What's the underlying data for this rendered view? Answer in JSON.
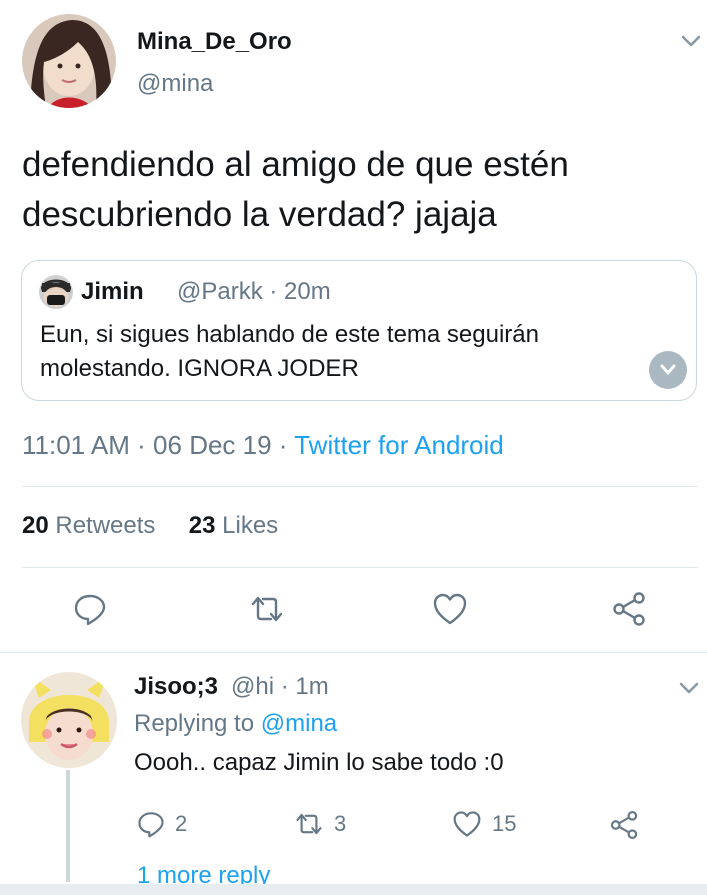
{
  "tweet": {
    "author_name": "Mina_De_Oro",
    "author_handle": "@mina",
    "text": "defendiendo al amigo de que estén descubriendo la verdad? jajaja",
    "quote": {
      "name": "Jimin",
      "handle": "@Parkk",
      "separator": " · ",
      "time": "20m",
      "text": "Eun, si sigues hablando de este tema seguirán molestando. IGNORA JODER"
    },
    "time": "11:01 AM",
    "date": "06 Dec 19",
    "separator": " · ",
    "source": "Twitter for Android",
    "retweets_count": "20",
    "retweets_label": "Retweets",
    "likes_count": "23",
    "likes_label": "Likes",
    "actions": [
      "reply-icon",
      "retweet-icon",
      "like-icon",
      "share-icon"
    ]
  },
  "reply": {
    "author_name": "Jisoo;3",
    "author_handle": "@hi",
    "separator": " · ",
    "time": "1m",
    "replying_prefix": "Replying to ",
    "replying_to": "@mina",
    "text": "Oooh.. capaz Jimin lo sabe todo :0",
    "reply_count": "2",
    "retweet_count": "3",
    "like_count": "15",
    "more_replies": "1 more reply"
  },
  "colors": {
    "accent": "#1da1f2",
    "muted": "#657786",
    "border": "#e1e8ed"
  }
}
